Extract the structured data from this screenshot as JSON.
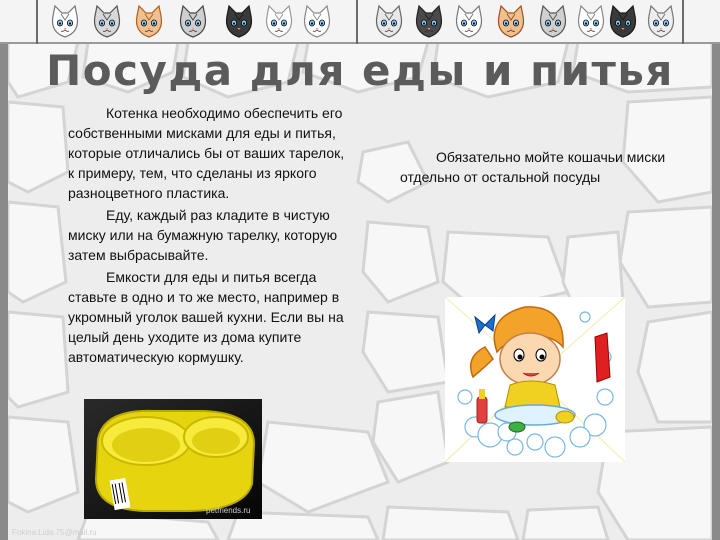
{
  "slide": {
    "title": "Посуда для еды и питья",
    "left_paragraphs": [
      "Котенка  необходимо обеспечить его собственными мисками для еды и питья, которые отличались бы от ваших тарелок, к примеру, тем, что сделаны из яркого разноцветного  пластика.",
      "Еду, каждый раз кладите в чистую миску или на бумажную тарелку, которую затем выбрасывайте.",
      "Емкости для еды и питья всегда ставьте в одно и то же место, например в укромный уголок вашей кухни. Если вы на целый день уходите из дома купите автоматическую кормушку."
    ],
    "right_paragraph": "Обязательно мойте кошачьи миски отдельно от остальной посуды",
    "bowl_photo_watermark": "petfriends.ru",
    "footer": "Fokina.Lida.75@mail.ru"
  },
  "colors": {
    "title": "#5b5b5b",
    "background": "#ededed",
    "bowl": "#f2e21a",
    "frame": "#8a8a8a"
  },
  "icons": [
    "cat-face-icon"
  ]
}
